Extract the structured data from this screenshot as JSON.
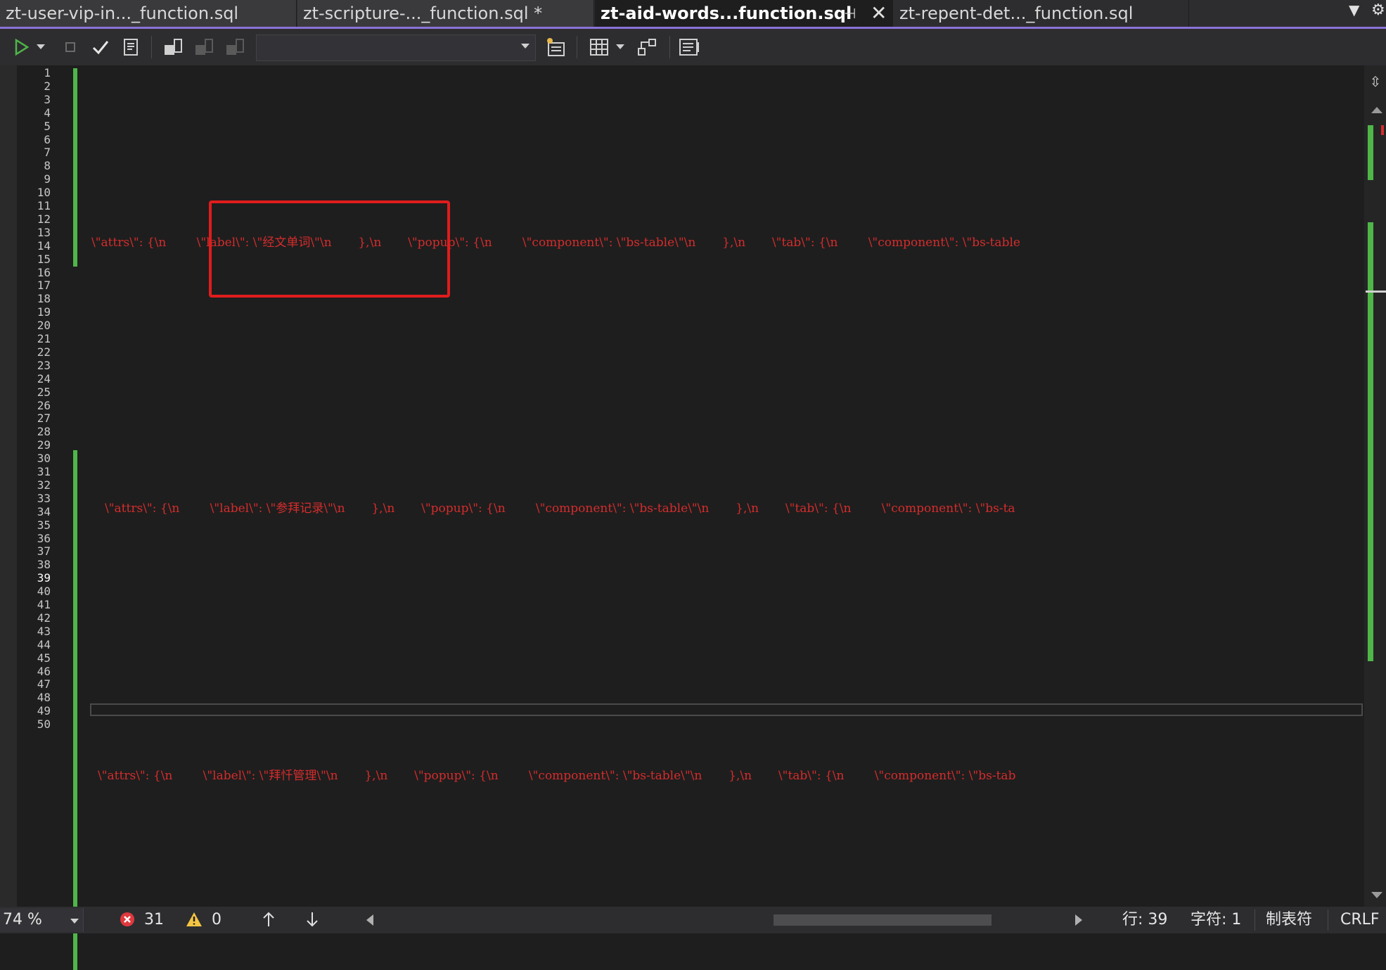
{
  "tabs": [
    {
      "label": "zt-user-vip-in..._function.sql"
    },
    {
      "label": "zt-scripture-..._function.sql *"
    },
    {
      "label": "zt-aid-words...function.sql"
    },
    {
      "label": "zt-repent-det..._function.sql"
    }
  ],
  "toolbar": {
    "database_selector_value": "",
    "icons": [
      "execute-icon",
      "execute-dropdown-icon",
      "stop-icon",
      "parse-check-icon",
      "estimated-plan-icon",
      "connect-icon",
      "disconnect-icon",
      "change-connection-icon",
      "query-options-icon",
      "results-to-grid-icon",
      "results-dropdown-icon",
      "show-plan-icon",
      "results-pane-icon"
    ]
  },
  "editor": {
    "line_numbers": [
      "1",
      "2",
      "3",
      "4",
      "5",
      "6",
      "7",
      "8",
      "9",
      "10",
      "11",
      "12",
      "13",
      "14",
      "15",
      "16",
      "17",
      "18",
      "19",
      "20",
      "21",
      "22",
      "23",
      "24",
      "25",
      "26",
      "27",
      "28",
      "29",
      "30",
      "31",
      "32",
      "33",
      "34",
      "35",
      "36",
      "37",
      "38",
      "39",
      "40",
      "41",
      "42",
      "43",
      "44",
      "45",
      "46",
      "47",
      "48",
      "49",
      "50"
    ],
    "current_line": "39",
    "code_lines": {
      "line11": "\\\"attrs\\\": {\\n        \\\"label\\\": \\\"经文单词\\\"\\n       },\\n       \\\"popup\\\": {\\n        \\\"component\\\": \\\"bs-table\\\"\\n       },\\n       \\\"tab\\\": {\\n        \\\"component\\\": \\\"bs-table",
      "line27": "\\\"attrs\\\": {\\n        \\\"label\\\": \\\"参拜记录\\\"\\n       },\\n       \\\"popup\\\": {\\n        \\\"component\\\": \\\"bs-table\\\"\\n       },\\n       \\\"tab\\\": {\\n        \\\"component\\\": \\\"bs-ta",
      "line43": "\\\"attrs\\\": {\\n        \\\"label\\\": \\\"拜忏管理\\\"\\n       },\\n       \\\"popup\\\": {\\n        \\\"component\\\": \\\"bs-table\\\"\\n       },\\n       \\\"tab\\\": {\\n        \\\"component\\\": \\\"bs-tab"
    },
    "colors": {
      "string": "#d62c2c",
      "change_bar": "#4fb648",
      "highlight_box": "#e01c1c",
      "tab_accent": "#8a72d8"
    }
  },
  "statusbar": {
    "zoom": "74 %",
    "errors": "31",
    "warnings": "0",
    "line": "行: 39",
    "char": "字符: 1",
    "indent": "制表符",
    "eol": "CRLF"
  }
}
